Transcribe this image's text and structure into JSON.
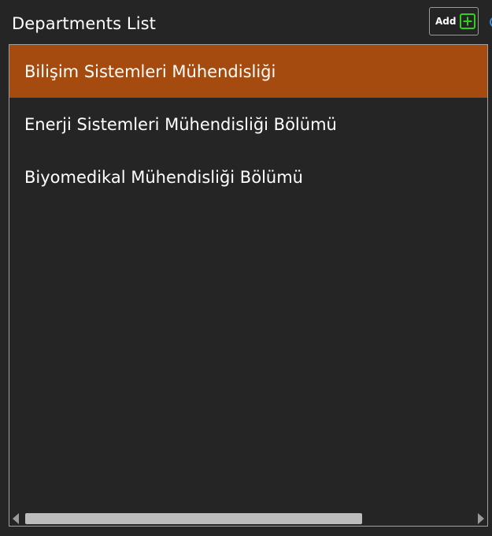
{
  "header": {
    "title": "Departments List",
    "add_label": "Add",
    "add_icon": "plus-square-icon"
  },
  "departments": {
    "items": [
      {
        "label": "Bilişim Sistemleri Mühendisliği",
        "selected": true
      },
      {
        "label": "Enerji Sistemleri Mühendisliği Bölümü",
        "selected": false
      },
      {
        "label": "Biyomedikal Mühendisliği Bölümü",
        "selected": false
      }
    ],
    "horizontal_scroll_fraction": 0.0
  },
  "colors": {
    "background": "#252525",
    "selected_item": "#a64b10",
    "plus_icon": "#2fd11b",
    "border": "#a0a0a0",
    "scrollbar_thumb": "#bdbdbd"
  }
}
